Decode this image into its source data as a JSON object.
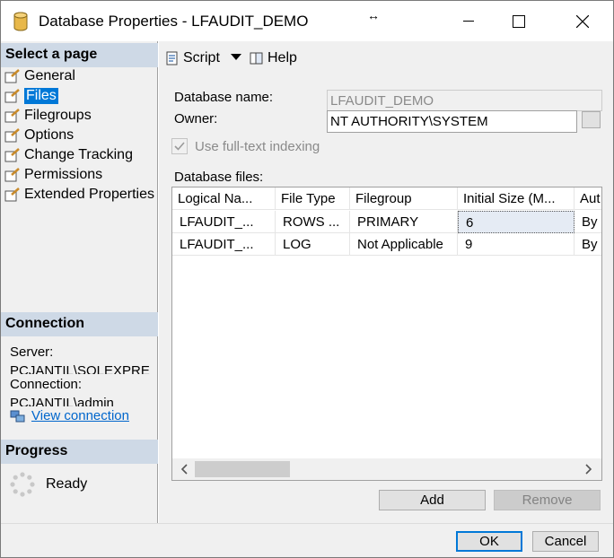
{
  "window": {
    "title": "Database Properties - LFAUDIT_DEMO",
    "resize_glyph": "↔"
  },
  "left": {
    "select_page_header": "Select a page",
    "pages": [
      {
        "label": "General",
        "icon": "wrench-page-icon"
      },
      {
        "label": "Files",
        "icon": "wrench-page-icon",
        "selected": true
      },
      {
        "label": "Filegroups",
        "icon": "wrench-page-icon"
      },
      {
        "label": "Options",
        "icon": "wrench-page-icon"
      },
      {
        "label": "Change Tracking",
        "icon": "wrench-page-icon"
      },
      {
        "label": "Permissions",
        "icon": "wrench-page-icon"
      },
      {
        "label": "Extended Properties",
        "icon": "wrench-page-icon"
      }
    ],
    "connection_header": "Connection",
    "server_label": "Server:",
    "server_value": "PCJANTIL\\SQLEXPRE",
    "connection_label": "Connection:",
    "connection_value": "PCJANTIL\\admin",
    "view_connection": "View connection",
    "progress_header": "Progress",
    "progress_status": "Ready"
  },
  "toolbar": {
    "script_label": "Script",
    "help_label": "Help"
  },
  "form": {
    "database_name_label": "Database name:",
    "database_name_value": "LFAUDIT_DEMO",
    "owner_label": "Owner:",
    "owner_value": "NT AUTHORITY\\SYSTEM",
    "fulltext_label": "Use full-text indexing",
    "fulltext_checked": true,
    "database_files_label": "Database files:"
  },
  "files_grid": {
    "columns": [
      "Logical Na...",
      "File Type",
      "Filegroup",
      "Initial Size (M...",
      "Aut"
    ],
    "rows": [
      [
        "LFAUDIT_...",
        "ROWS ...",
        "PRIMARY",
        "6",
        "By"
      ],
      [
        "LFAUDIT_...",
        "LOG",
        "Not Applicable",
        "9",
        "By"
      ]
    ]
  },
  "buttons": {
    "add": "Add",
    "remove": "Remove",
    "ok": "OK",
    "cancel": "Cancel"
  },
  "colors": {
    "selection": "#0078d7",
    "section_header": "#ced9e6",
    "link": "#0066cc"
  }
}
